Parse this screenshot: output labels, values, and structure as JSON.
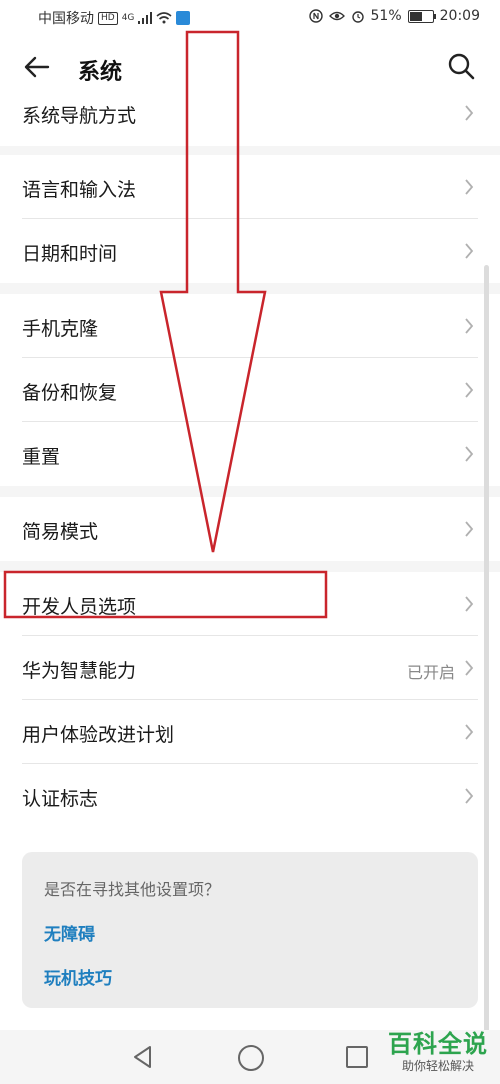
{
  "status_bar": {
    "carrier": "中国移动",
    "hd": "HD",
    "network": "4G",
    "battery": "51%",
    "time": "20:09",
    "battery_level": 0.51
  },
  "header": {
    "title": "系统"
  },
  "groups": [
    {
      "items": [
        {
          "label": "系统导航方式"
        }
      ]
    },
    {
      "items": [
        {
          "label": "语言和输入法"
        },
        {
          "label": "日期和时间"
        }
      ]
    },
    {
      "items": [
        {
          "label": "手机克隆"
        },
        {
          "label": "备份和恢复"
        },
        {
          "label": "重置"
        }
      ]
    },
    {
      "items": [
        {
          "label": "简易模式"
        }
      ]
    },
    {
      "items": [
        {
          "label": "开发人员选项"
        },
        {
          "label": "华为智慧能力",
          "value": "已开启"
        },
        {
          "label": "用户体验改进计划"
        },
        {
          "label": "认证标志"
        }
      ]
    }
  ],
  "suggestions": {
    "title": "是否在寻找其他设置项？",
    "links": [
      "无障碍",
      "玩机技巧"
    ]
  },
  "watermark": {
    "main": "百科全说",
    "sub": "助你轻松解决"
  },
  "colors": {
    "annotation": "#c9252c",
    "link": "#1f7fbf",
    "watermark": "#2da44e"
  },
  "icons": [
    "back-arrow-icon",
    "search-icon",
    "chevron-right-icon",
    "nav-back-icon",
    "nav-home-icon",
    "nav-recent-icon"
  ]
}
